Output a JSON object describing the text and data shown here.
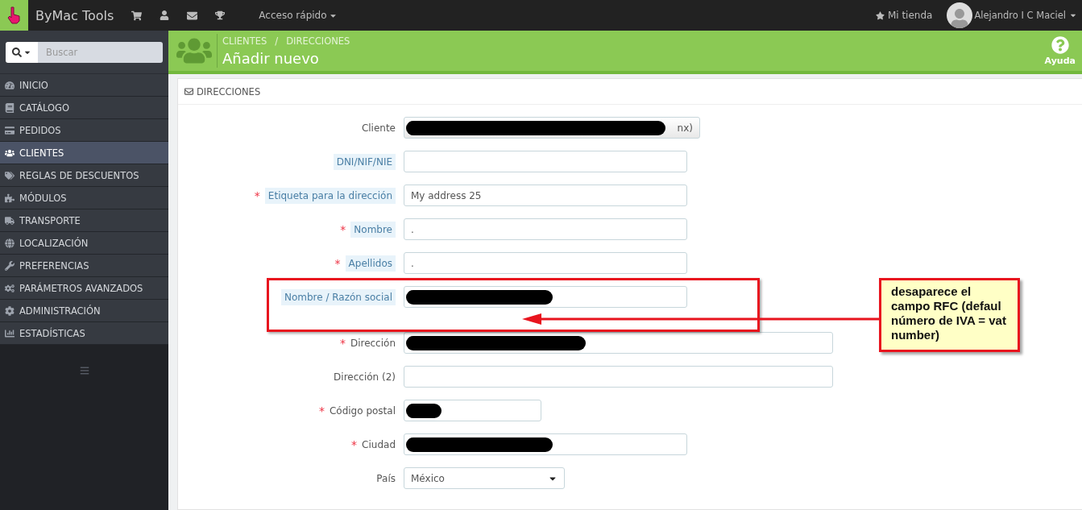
{
  "topbar": {
    "brand": "ByMac Tools",
    "quick_access": "Acceso rápido",
    "store": "Mi tienda",
    "user": "Alejandro I C Maciel"
  },
  "sidebar": {
    "search_placeholder": "Buscar",
    "items": [
      {
        "label": "INICIO",
        "selected": false
      },
      {
        "label": "CATÁLOGO",
        "selected": false
      },
      {
        "label": "PEDIDOS",
        "selected": false
      },
      {
        "label": "CLIENTES",
        "selected": true
      },
      {
        "label": "REGLAS DE DESCUENTOS",
        "selected": false
      },
      {
        "label": "MÓDULOS",
        "selected": false
      },
      {
        "label": "TRANSPORTE",
        "selected": false
      },
      {
        "label": "LOCALIZACIÓN",
        "selected": false
      },
      {
        "label": "PREFERENCIAS",
        "selected": false
      },
      {
        "label": "PARÁMETROS AVANZADOS",
        "selected": false
      },
      {
        "label": "ADMINISTRACIÓN",
        "selected": false
      },
      {
        "label": "ESTADÍSTICAS",
        "selected": false
      }
    ]
  },
  "header": {
    "breadcrumb": [
      "CLIENTES",
      "DIRECCIONES"
    ],
    "breadcrumb_separator": "/",
    "title": "Añadir nuevo",
    "help": "Ayuda"
  },
  "panel": {
    "title": "DIRECCIONES",
    "required_mark": "*",
    "fields": [
      {
        "label": "Cliente",
        "required": false,
        "hint": false,
        "kind": "client",
        "value": "nx)",
        "redacted": true
      },
      {
        "label": "DNI/NIF/NIE",
        "required": false,
        "hint": true,
        "kind": "text",
        "redacted": false
      },
      {
        "label": "Etiqueta para la dirección",
        "required": true,
        "hint": true,
        "kind": "text",
        "value": "My address 25",
        "redacted": false
      },
      {
        "label": "Nombre",
        "required": true,
        "hint": true,
        "kind": "text",
        "value": ".",
        "redacted": false
      },
      {
        "label": "Apellidos",
        "required": true,
        "hint": true,
        "kind": "text",
        "value": ".",
        "redacted": false
      },
      {
        "label": "Nombre / Razón social",
        "required": false,
        "hint": true,
        "kind": "text",
        "redacted": true
      },
      {
        "label": "Dirección",
        "required": true,
        "hint": false,
        "kind": "long-text",
        "redacted": true
      },
      {
        "label": "Dirección (2)",
        "required": false,
        "hint": false,
        "kind": "long-text",
        "redacted": false
      },
      {
        "label": "Código postal",
        "required": true,
        "hint": false,
        "kind": "short-text",
        "redacted": true
      },
      {
        "label": "Ciudad",
        "required": true,
        "hint": false,
        "kind": "text",
        "redacted": true
      },
      {
        "label": "País",
        "required": false,
        "hint": false,
        "kind": "select",
        "value": "México",
        "redacted": false
      }
    ]
  },
  "annotation": {
    "note": "desaparece el campo RFC (defaul número de IVA = vat number)"
  }
}
